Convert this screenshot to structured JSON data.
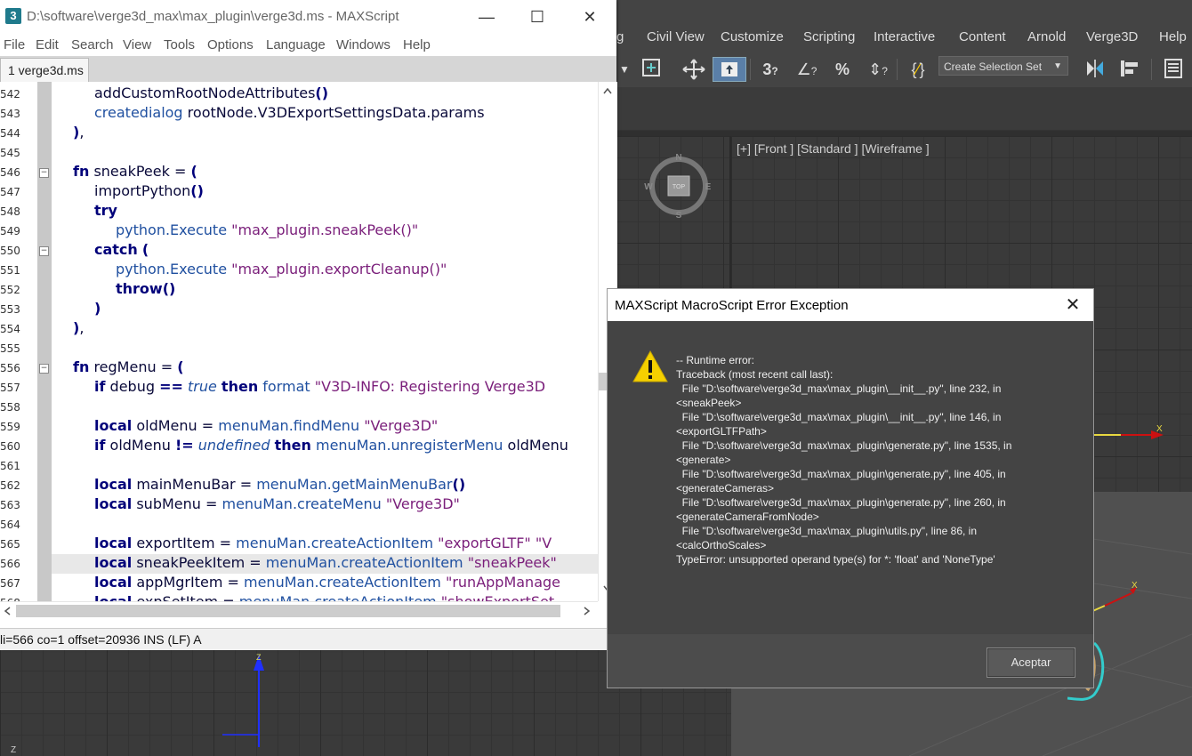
{
  "max": {
    "menu": [
      "g",
      "Civil View",
      "Customize",
      "Scripting",
      "Interactive",
      "Content",
      "Arnold",
      "Verge3D",
      "Help"
    ],
    "selection_set_placeholder": "Create Selection Set",
    "viewport_front_label": "[+] [Front ] [Standard ] [Wireframe ]",
    "viewcube": {
      "n": "N",
      "s": "S",
      "e": "E",
      "w": "W",
      "center": "TOP"
    },
    "axis_labels": {
      "x": "X",
      "z": "Z"
    }
  },
  "editor": {
    "title": "D:\\software\\verge3d_max\\max_plugin\\verge3d.ms - MAXScript",
    "app_icon": "3",
    "menu": [
      "File",
      "Edit",
      "Search",
      "View",
      "Tools",
      "Options",
      "Language",
      "Windows",
      "Help"
    ],
    "tab": "1 verge3d.ms",
    "line_numbers": [
      "542",
      "543",
      "544",
      "545",
      "546",
      "547",
      "548",
      "549",
      "550",
      "551",
      "552",
      "553",
      "554",
      "555",
      "556",
      "557",
      "558",
      "559",
      "560",
      "561",
      "562",
      "563",
      "564",
      "565",
      "566",
      "567",
      "568"
    ],
    "status": "li=566 co=1 offset=20936 INS (LF) A"
  },
  "dialog": {
    "title": "MAXScript MacroScript Error Exception",
    "message": [
      "-- Runtime error:",
      "Traceback (most recent call last):",
      "  File \"D:\\software\\verge3d_max\\max_plugin\\__init__.py\", line 232, in",
      "<sneakPeek>",
      "  File \"D:\\software\\verge3d_max\\max_plugin\\__init__.py\", line 146, in",
      "<exportGLTFPath>",
      "  File \"D:\\software\\verge3d_max\\max_plugin\\generate.py\", line 1535, in",
      "<generate>",
      "  File \"D:\\software\\verge3d_max\\max_plugin\\generate.py\", line 405, in",
      "<generateCameras>",
      "  File \"D:\\software\\verge3d_max\\max_plugin\\generate.py\", line 260, in",
      "<generateCameraFromNode>",
      "  File \"D:\\software\\verge3d_max\\max_plugin\\utils.py\", line 86, in",
      "<calcOrthoScales>",
      "TypeError: unsupported operand type(s) for *: 'float' and 'NoneType'"
    ],
    "ok_button": "Aceptar",
    "icon": "warning-icon"
  },
  "colors": {
    "keyword": "#00007a",
    "function": "#2050a0",
    "string": "#7a1e7a",
    "dialog_bg": "#444444",
    "max_bg": "#444444"
  }
}
